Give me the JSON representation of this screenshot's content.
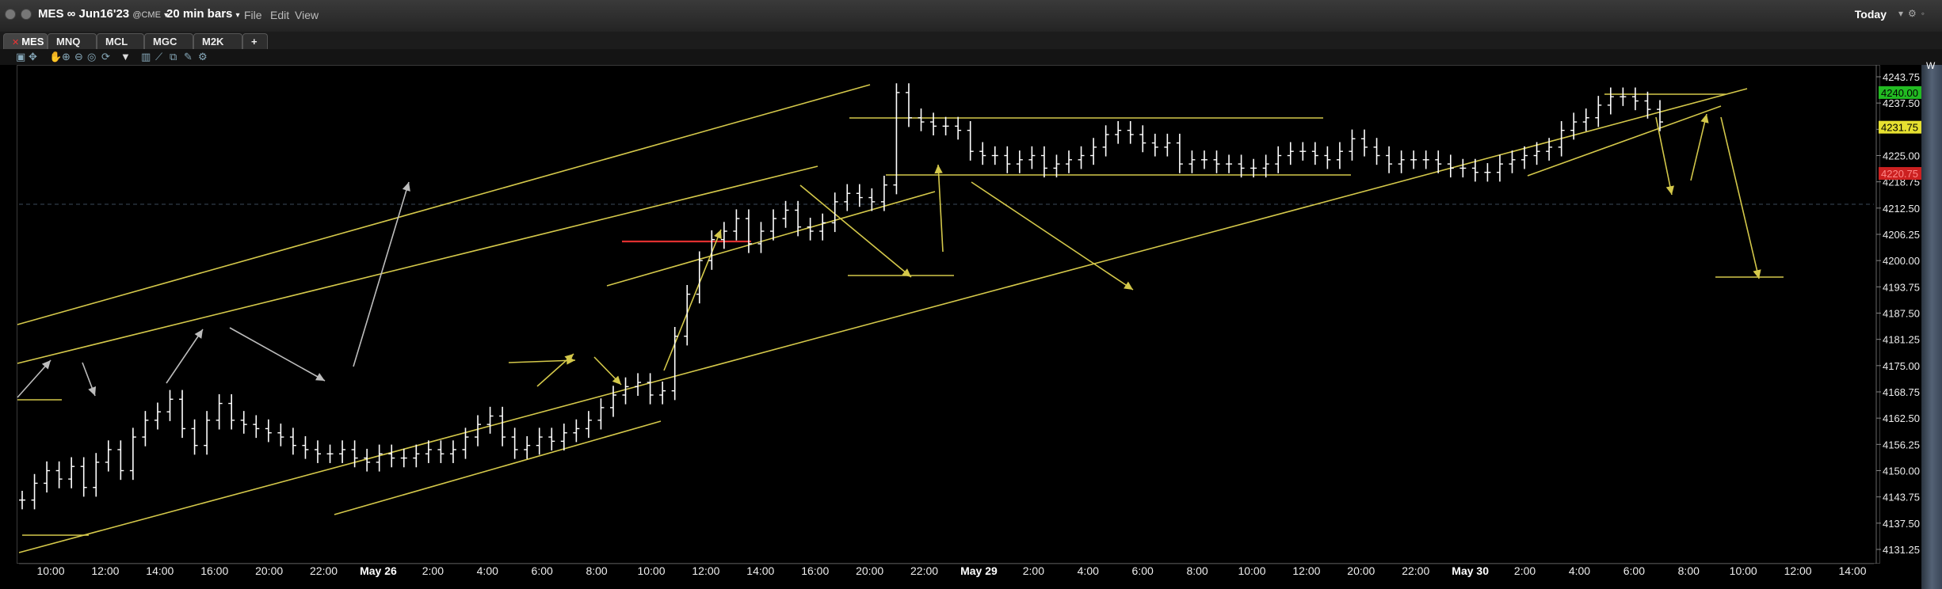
{
  "header": {
    "symbol": "MES ∞ Jun16'23",
    "exchange": "@CME",
    "bar_size": "20 min bars",
    "menus": [
      "File",
      "Edit",
      "View"
    ],
    "today_label": "Today"
  },
  "tabs": [
    "MES",
    "MNQ",
    "MCL",
    "MGC",
    "M2K",
    "+"
  ],
  "colors": {
    "background": "#000000",
    "drawing": "#d4c84a",
    "price_line": "#ffffff",
    "red_line": "#e03030",
    "grey_arrow": "#bdbdbd"
  },
  "axis": {
    "y_labels": [
      "4243.75",
      "4237.50",
      "4231.25",
      "4225.00",
      "4218.75",
      "4212.50",
      "4206.25",
      "4200.00",
      "4193.75",
      "4187.50",
      "4181.25",
      "4175.00",
      "4168.75",
      "4162.50",
      "4156.25",
      "4150.00",
      "4143.75",
      "4137.50",
      "4131.25"
    ],
    "x_labels": [
      {
        "t": "10:00"
      },
      {
        "t": "12:00"
      },
      {
        "t": "14:00"
      },
      {
        "t": "16:00"
      },
      {
        "t": "20:00"
      },
      {
        "t": "22:00"
      },
      {
        "t": "May 26",
        "bold": true
      },
      {
        "t": "2:00"
      },
      {
        "t": "4:00"
      },
      {
        "t": "6:00"
      },
      {
        "t": "8:00"
      },
      {
        "t": "10:00"
      },
      {
        "t": "12:00"
      },
      {
        "t": "14:00"
      },
      {
        "t": "16:00"
      },
      {
        "t": "20:00"
      },
      {
        "t": "22:00"
      },
      {
        "t": "May 29",
        "bold": true
      },
      {
        "t": "2:00"
      },
      {
        "t": "4:00"
      },
      {
        "t": "6:00"
      },
      {
        "t": "8:00"
      },
      {
        "t": "10:00"
      },
      {
        "t": "12:00"
      },
      {
        "t": "20:00"
      },
      {
        "t": "22:00"
      },
      {
        "t": "May 30",
        "bold": true
      },
      {
        "t": "2:00"
      },
      {
        "t": "4:00"
      },
      {
        "t": "6:00"
      },
      {
        "t": "8:00"
      },
      {
        "t": "10:00"
      },
      {
        "t": "12:00"
      },
      {
        "t": "14:00"
      }
    ]
  },
  "price_tags": [
    {
      "value": "4240.00",
      "bg": "#22bb22",
      "fg": "#000000"
    },
    {
      "value": "4231.75",
      "bg": "#e6e030",
      "fg": "#000000"
    },
    {
      "value": "4220.75",
      "bg": "#cc2020",
      "fg": "#ff8888"
    }
  ],
  "chart_data": {
    "type": "bar",
    "title": "",
    "ylim": [
      4128,
      4247
    ],
    "grid": false,
    "series": [
      {
        "values": [
          4143,
          4147,
          4150,
          4148,
          4151,
          4146,
          4152,
          4155,
          4150,
          4158,
          4162,
          4164,
          4167,
          4160,
          4156,
          4162,
          4166,
          4162,
          4161,
          4160,
          4159,
          4158,
          4156,
          4155,
          4154,
          4154,
          4155,
          4153,
          4152,
          4154,
          4153,
          4153,
          4154,
          4155,
          4154,
          4155,
          4158,
          4161,
          4163,
          4158,
          4155,
          4156,
          4158,
          4157,
          4159,
          4160,
          4162,
          4165,
          4168,
          4170,
          4171,
          4168,
          4169,
          4182,
          4192,
          4200,
          4205,
          4207,
          4210,
          4204,
          4207,
          4210,
          4212,
          4208,
          4207,
          4209,
          4214,
          4216,
          4215,
          4214,
          4218,
          4240,
          4234,
          4233,
          4232,
          4232,
          4231,
          4226,
          4225,
          4225,
          4223,
          4224,
          4225,
          4222,
          4223,
          4224,
          4225,
          4227,
          4230,
          4231,
          4230,
          4228,
          4227,
          4228,
          4223,
          4224,
          4224,
          4223,
          4223,
          4222,
          4222,
          4223,
          4225,
          4226,
          4226,
          4225,
          4224,
          4226,
          4229,
          4227,
          4225,
          4223,
          4224,
          4224,
          4224,
          4223,
          4222,
          4222,
          4221,
          4221,
          4223,
          4224,
          4225,
          4226,
          4227,
          4231,
          4233,
          4234,
          4237,
          4239,
          4239,
          4238,
          4236,
          4233
        ]
      }
    ]
  }
}
